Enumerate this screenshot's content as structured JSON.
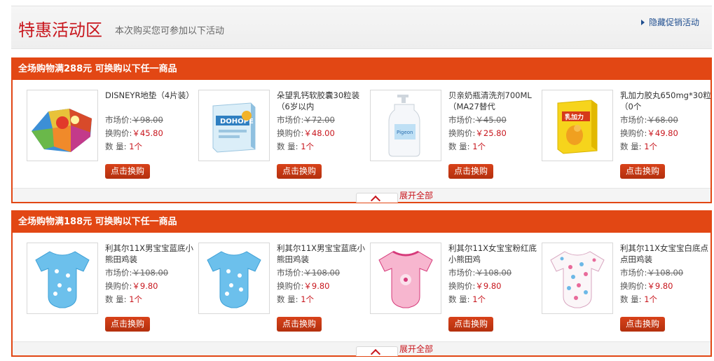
{
  "header": {
    "title": "特惠活动区",
    "subtitle": "本次购买您可参加以下活动",
    "hide_link": "隐藏促销活动"
  },
  "labels": {
    "market_price": "市场价:",
    "exchange_price": "换购价:",
    "quantity": "数   量:",
    "buy_button": "点击换购",
    "expand": "展开全部"
  },
  "colors": {
    "accent": "#e24714",
    "price_red": "#c8161d",
    "link_blue": "#1f4e8f"
  },
  "sections": [
    {
      "title": "全场购物满288元 可换购以下任一商品",
      "products": [
        {
          "name": "DISNEYR地垫（4片装）",
          "market_price": "￥98.00",
          "exchange_price": "￥45.80",
          "quantity": "1个",
          "image_icon": "puzzle-mat-icon"
        },
        {
          "name": "朵望乳钙软胶囊30粒装（6岁以内",
          "market_price": "￥72.00",
          "exchange_price": "￥48.00",
          "quantity": "1个",
          "image_icon": "calcium-box-icon"
        },
        {
          "name": "贝亲奶瓶清洗剂700ML（MA27替代",
          "market_price": "￥45.00",
          "exchange_price": "￥25.80",
          "quantity": "1个",
          "image_icon": "bottle-cleaner-icon"
        },
        {
          "name": "乳加力胶丸650mg*30粒（0个",
          "market_price": "￥68.00",
          "exchange_price": "￥49.80",
          "quantity": "1个",
          "image_icon": "supplement-box-icon"
        }
      ]
    },
    {
      "title": "全场购物满188元 可换购以下任一商品",
      "products": [
        {
          "name": "利其尔11X男宝宝蓝底小熊田鸡装",
          "market_price": "￥108.00",
          "exchange_price": "￥9.80",
          "quantity": "1个",
          "image_icon": "blue-onesie-icon"
        },
        {
          "name": "利其尔11X男宝宝蓝底小熊田鸡装",
          "market_price": "￥108.00",
          "exchange_price": "￥9.80",
          "quantity": "1个",
          "image_icon": "blue-onesie-icon"
        },
        {
          "name": "利其尔11X女宝宝粉红底小熊田鸡",
          "market_price": "￥108.00",
          "exchange_price": "￥9.80",
          "quantity": "1个",
          "image_icon": "pink-onesie-icon"
        },
        {
          "name": "利其尔11X女宝宝白底点点田鸡装",
          "market_price": "￥108.00",
          "exchange_price": "￥9.80",
          "quantity": "1个",
          "image_icon": "dotted-onesie-icon"
        }
      ]
    }
  ]
}
